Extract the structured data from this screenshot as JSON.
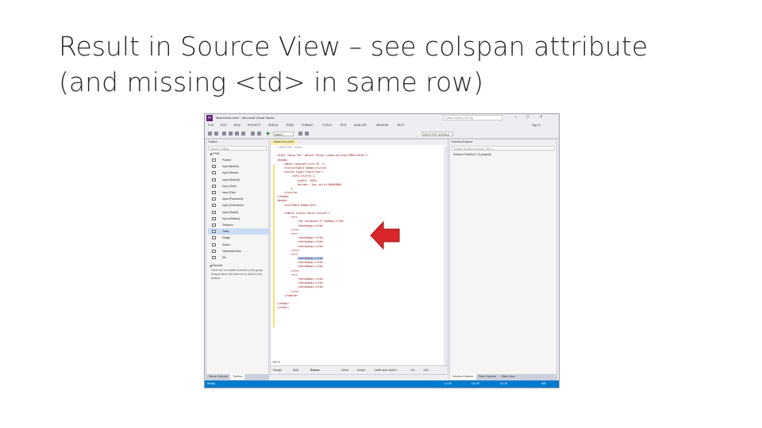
{
  "slide": {
    "title_line1": "Result in Source View – see colspan attribute",
    "title_line2": "(and missing <td> in same row)"
  },
  "window": {
    "title": "TableDemo.html* - Microsoft Visual Studio",
    "quick_launch": "Quick Launch (Ctrl+Q)",
    "signin": "Sign in"
  },
  "menu": [
    "FILE",
    "EDIT",
    "VIEW",
    "PROJECT",
    "DEBUG",
    "TEAM",
    "FORMAT",
    "TOOLS",
    "TEST",
    "ANALYZE",
    "WINDOW",
    "HELP"
  ],
  "toolbar": {
    "attach": "Attach...",
    "doctype": "DOCTYPE: XHTML5"
  },
  "toolbox": {
    "header": "Toolbox",
    "search_placeholder": "Search Toolbox",
    "group_html": "◢ HTML",
    "group_general": "◢ General",
    "general_text": "There are no usable controls in this group. Drag an item onto this text to add it to the toolbox.",
    "items": [
      "Pointer",
      "Input (Button)",
      "Input (Reset)",
      "Input (Submit)",
      "Input (Text)",
      "Input (File)",
      "Input (Password)",
      "Input (Checkbox)",
      "Input (Radio)",
      "Input (Hidden)",
      "Textarea",
      "Table",
      "Image",
      "Select",
      "Horizontal Rule",
      "Div"
    ],
    "selected_index": 11,
    "tabs": [
      "Server Explorer",
      "Toolbox"
    ]
  },
  "editor": {
    "tab": "TableDemo.html*",
    "zoom": "100 %",
    "code": [
      "<!DOCTYPE html>",
      "",
      "<html lang=\"en\" xmlns=\"http://www.w3.org/1999/xhtml\">",
      "<head>",
      "    <meta charset=\"utf-8\" />",
      "    <title>Table Demo</title>",
      "    <style type=\"text/css\">",
      "        .auto-style1 {",
      "            width: 100%;",
      "            border: 1px solid #000000;",
      "        }",
      "    </style>",
      "</head>",
      "<body>",
      "    <h1>Table Demo</h1>",
      "",
      "    <table class=\"auto-style1\">",
      "        <tr>",
      "            <td colspan=\"2\">&nbsp;</td>",
      "            <td>&nbsp;</td>",
      "        </tr>",
      "        <tr>",
      "            <td>&nbsp;</td>",
      "            <td>&nbsp;</td>",
      "            <td>&nbsp;</td>",
      "        </tr>",
      "        <tr>",
      "            <td>&nbsp;</td>",
      "            <td>&nbsp;</td>",
      "            <td>&nbsp;</td>",
      "        </tr>",
      "        <tr>",
      "            <td>&nbsp;</td>",
      "            <td>&nbsp;</td>",
      "            <td>&nbsp;</td>",
      "        </tr>",
      "    </table>",
      "",
      "</body>",
      "</html>"
    ],
    "view_design": "Design",
    "view_split": "Split",
    "view_source": "Source",
    "crumbs": [
      "<html>",
      "<body>",
      "<table.auto-style1>",
      "<tr>",
      "<td>"
    ]
  },
  "solution": {
    "header": "Solution Explorer",
    "search_placeholder": "Search Solution Explorer (Ctrl+;)",
    "item": "Solution 'Solution1' (0 projects)",
    "tabs": [
      "Solution Explorer",
      "Team Explorer",
      "Class View"
    ]
  },
  "status": {
    "ready": "Ready",
    "ln": "Ln 26",
    "col": "Col 29",
    "ch": "Ch 29",
    "ins": "INS"
  },
  "colors": {
    "accent": "#68217a",
    "status_bar": "#007acc",
    "arrow": "#d9262b"
  }
}
